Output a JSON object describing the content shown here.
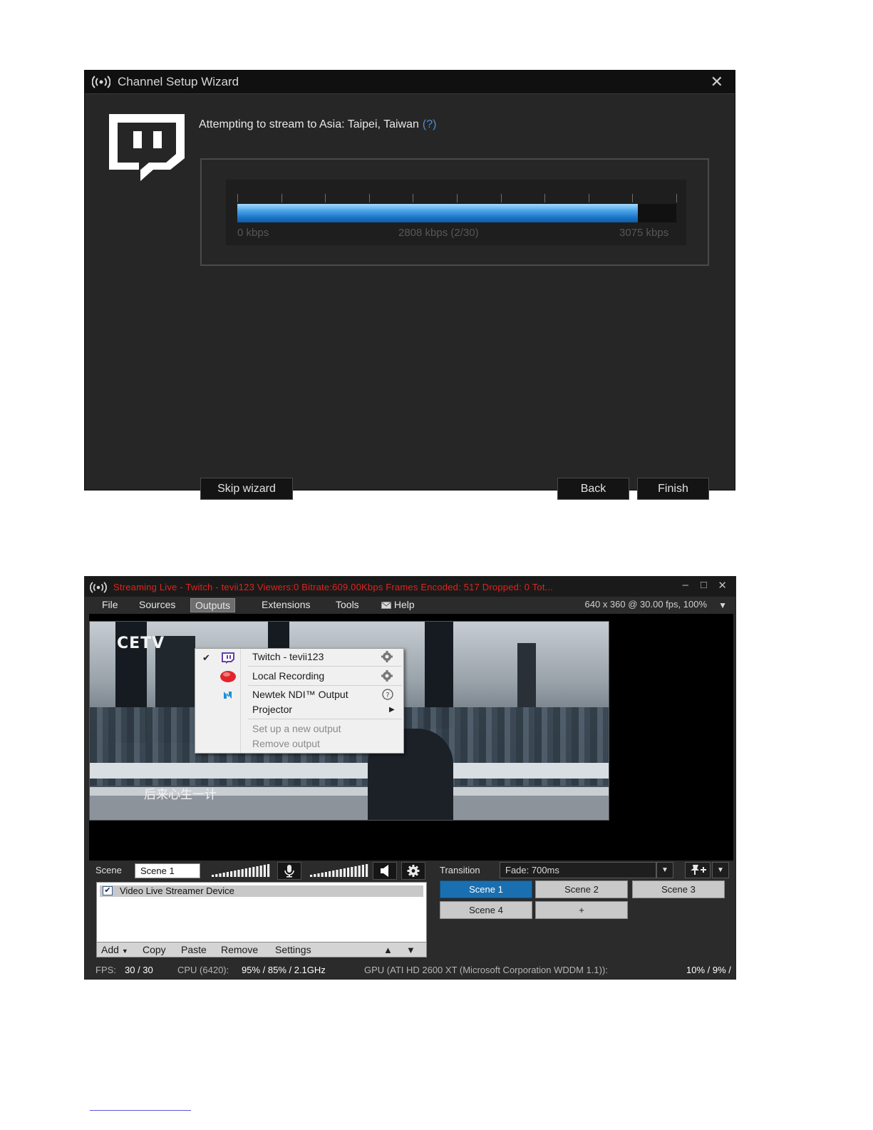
{
  "wizard": {
    "title": "Channel Setup Wizard",
    "close_glyph": "✕",
    "attempt_text": "Attempting to stream to Asia: Taipei, Taiwan",
    "help_link": "(?)",
    "meter": {
      "min_label": "0 kbps",
      "mid_label": "2808 kbps (2/30)",
      "max_label": "3075 kbps",
      "fill_fraction": 0.913
    },
    "buttons": {
      "skip": "Skip wizard",
      "back": "Back",
      "finish": "Finish"
    },
    "icons": {
      "broadcast": "broadcast-icon",
      "logo": "twitch-logo-icon"
    }
  },
  "xsplit": {
    "status_text": "Streaming Live - Twitch - tevii123  Viewers:0  Bitrate:609.00Kbps  Frames Encoded: 517 Dropped: 0  Tot...",
    "window_controls": {
      "minimize": "–",
      "maximize": "□",
      "close": "✕"
    },
    "menu": [
      "File",
      "Sources",
      "Outputs",
      "Extensions",
      "Tools",
      "Help"
    ],
    "active_menu": "Outputs",
    "resolution": "640 x 360 @ 30.00 fps, 100%",
    "video": {
      "logo": "CETV",
      "subtitle": "后来心生一计"
    },
    "outputs_menu": {
      "items": [
        {
          "label": "Twitch - tevii123",
          "checked": true,
          "icon": "twitch-icon",
          "action": "gear-icon"
        },
        {
          "label": "Local Recording",
          "icon": "record-icon",
          "action": "gear-icon"
        },
        {
          "label": "Newtek NDI™ Output",
          "icon": "ndi-icon",
          "action": "help-icon"
        },
        {
          "label": "Projector",
          "submenu": true
        }
      ],
      "disabled_items": [
        "Set up a new output",
        "Remove output"
      ]
    },
    "scene_label": "Scene",
    "scene_name": "Scene 1",
    "sources": [
      {
        "name": "Video Live Streamer Device",
        "checked": true
      }
    ],
    "source_toolbar": {
      "add": "Add",
      "copy": "Copy",
      "paste": "Paste",
      "remove": "Remove",
      "settings": "Settings"
    },
    "transition_label": "Transition",
    "transition_value": "Fade: 700ms",
    "scenes": [
      "Scene 1",
      "Scene 2",
      "Scene 3",
      "Scene 4",
      "+"
    ],
    "active_scene": "Scene 1",
    "statusbar": {
      "fps_label": "FPS:",
      "fps_value": "30 / 30",
      "cpu_label": "CPU (6420):",
      "cpu_value": "95% / 85% / 2.1GHz",
      "gpu_label": "GPU (ATI HD 2600 XT (Microsoft Corporation WDDM 1.1)):",
      "gpu_value": "10% / 9% /"
    },
    "colors": {
      "status_red": "#e0231c",
      "active_scene_blue": "#1a6fb0",
      "twitch_purple": "#6441a5"
    }
  }
}
